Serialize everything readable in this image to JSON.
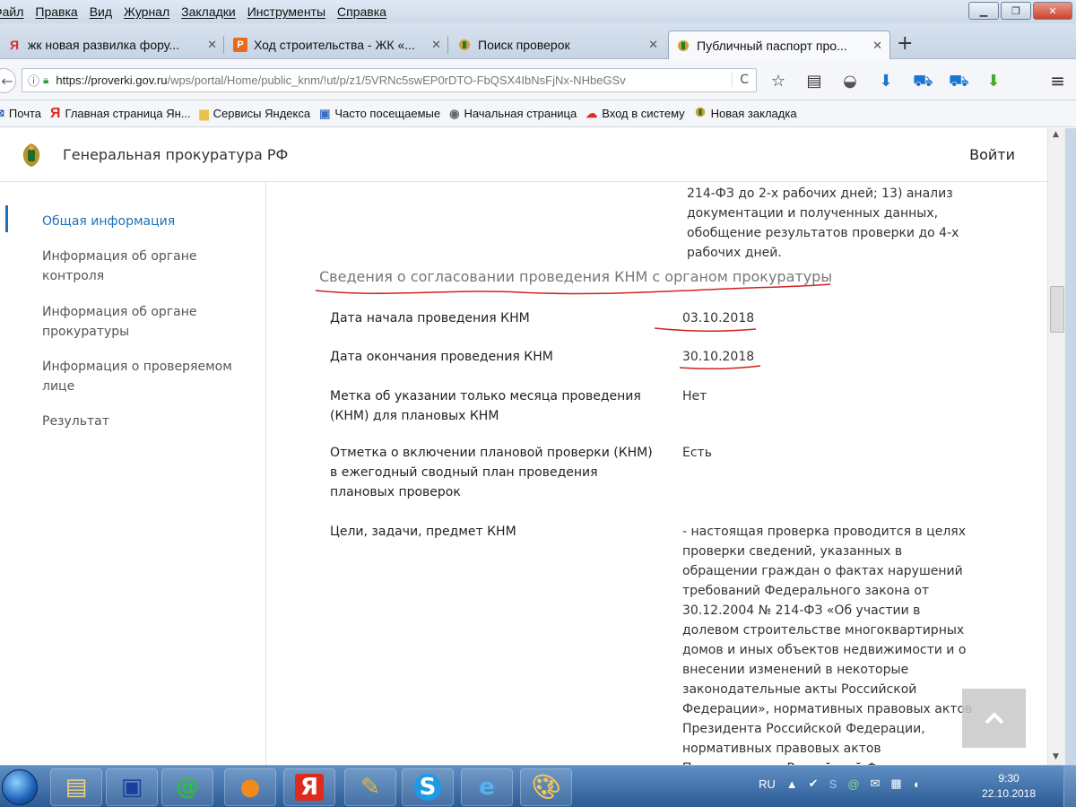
{
  "menubar": {
    "items": [
      "Файл",
      "Правка",
      "Вид",
      "Журнал",
      "Закладки",
      "Инструменты",
      "Справка"
    ]
  },
  "tabs": [
    {
      "label": "жк новая развилка фору...",
      "icon": "yandex-icon"
    },
    {
      "label": "Ход строительства - ЖК «...",
      "icon": "orange-p-icon"
    },
    {
      "label": "Поиск проверок",
      "icon": "emblem-icon"
    },
    {
      "label": "Публичный паспорт про...",
      "icon": "emblem-icon",
      "active": true
    }
  ],
  "navbar": {
    "url_host": "https://proverki.gov.ru",
    "url_path": "/wps/portal/Home/public_knm/!ut/p/z1/5VRNc5swEP0rDTO-FbQSX4IbNsFjNx-NHbeGSv"
  },
  "bookmarks": [
    {
      "label": "Почта",
      "icon": "mail-icon"
    },
    {
      "label": "Главная страница Ян...",
      "icon": "yandex-icon"
    },
    {
      "label": "Сервисы Яндекса",
      "icon": "folder-icon"
    },
    {
      "label": "Часто посещаемые",
      "icon": "bookmark-folder-icon"
    },
    {
      "label": "Начальная страница",
      "icon": "globe-icon"
    },
    {
      "label": "Вход в систему",
      "icon": "cloud-icon"
    },
    {
      "label": "Новая закладка",
      "icon": "emblem-icon"
    }
  ],
  "site": {
    "title": "Генеральная прокуратура РФ",
    "login": "Войти"
  },
  "sidebar": {
    "items": [
      {
        "label": "Общая информация",
        "active": true
      },
      {
        "label": "Информация об органе контроля"
      },
      {
        "label": "Информация об органе прокуратуры"
      },
      {
        "label": "Информация о проверяемом лице"
      },
      {
        "label": "Результат"
      }
    ]
  },
  "content": {
    "prev_text": "214-ФЗ до 2-х рабочих дней; 13) анализ документации и полученных данных, обобщение результатов проверки до 4-х рабочих дней.",
    "section_title": "Сведения о согласовании проведения КНМ с органом прокуратуры",
    "rows": [
      {
        "label": "Дата начала проведения КНМ",
        "value": "03.10.2018"
      },
      {
        "label": "Дата окончания проведения КНМ",
        "value": "30.10.2018"
      },
      {
        "label": "Метка об указании только месяца проведения (КНМ) для плановых КНМ",
        "value": "Нет"
      },
      {
        "label": "Отметка о включении плановой проверки (КНМ) в ежегодный сводный план проведения плановых проверок",
        "value": "Есть"
      },
      {
        "label": "Цели, задачи, предмет КНМ",
        "value": "- настоящая проверка проводится в целях проверки сведений, указанных в обращении граждан о фактах нарушений требований Федерального закона от 30.12.2004 № 214-ФЗ «Об участии в долевом строительстве многоквартирных домов и иных объектов недвижимости и о внесении изменений в некоторые законодательные акты Российской Федерации», нормативных правовых актов Президента Российской Федерации, нормативных правовых актов Правительства Российской Федерации, нормативных правовых актов уполномоченного органа, актов"
      }
    ]
  },
  "taskbar": {
    "lang": "RU",
    "time": "9:30",
    "date": "22.10.2018"
  },
  "colors": {
    "accent": "#1f6fb8",
    "annotation": "#d22020",
    "taskbar": "#2c5b95"
  }
}
